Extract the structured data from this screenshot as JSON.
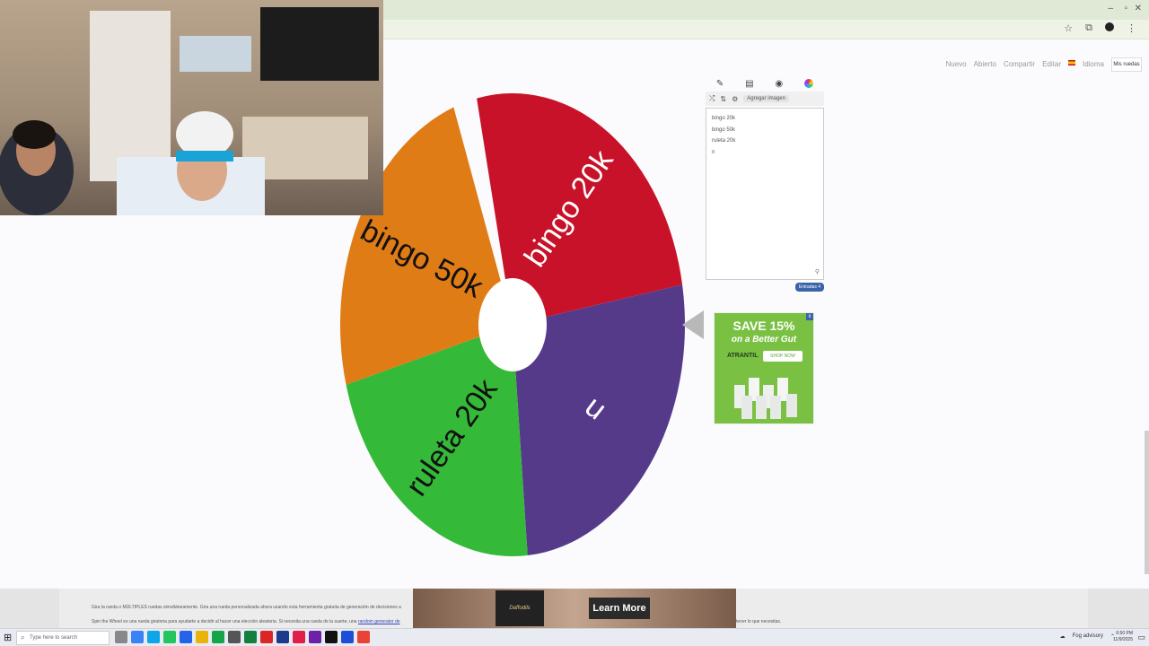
{
  "browser": {
    "window_controls": [
      "–",
      "▫",
      "✕"
    ],
    "toolbar_icons": [
      "☆",
      "⧉",
      "⋮"
    ]
  },
  "nav": {
    "items": [
      "Nuevo",
      "Abierto",
      "Compartir",
      "Editar",
      "",
      "Idioma",
      "Mis ruedas"
    ]
  },
  "wheel": {
    "entries": [
      "bingo 20k",
      "bingo 50k",
      "ruleta 20k",
      "n"
    ],
    "colors": [
      "#c81229",
      "#e07c16",
      "#35b938",
      "#563a8a"
    ]
  },
  "editor": {
    "tools": [
      "pencil-icon",
      "clipboard-icon",
      "eye-icon",
      "palette-icon"
    ],
    "actions": [
      "⤮",
      "⇅",
      "⚙"
    ],
    "add_image": "Agregar imagen",
    "lines": [
      "bingo 20k",
      "bingo 50k",
      "ruleta 20k",
      "n"
    ],
    "count_badge": "Entradas 4"
  },
  "ad": {
    "headline": "SAVE 15%",
    "subline": "on a Better Gut",
    "brand": "ATRANTIL",
    "button": "SHOP NOW",
    "close": "x"
  },
  "footer": {
    "line1": "Gira la rueda o MÚLTIPLES ruedas simultáneamente. Gira una rueda personalizada ahora usando esta herramienta gratuita de generación de decisiones a",
    "line2": "Spin the Wheel es una rueda giratoria para ayudarte a decidir al hacer una elección aleatoria. Si necesita una rueda de la suerte, una",
    "line2_link": "random generator de",
    "line2_end": "tener lo que necesitas.",
    "banner_logo": "Daffodils",
    "learn_more": "Learn More"
  },
  "taskbar": {
    "search_placeholder": "Type here to search",
    "weather": "Fog advisory",
    "time": "6:50 PM",
    "date": "11/9/2025"
  }
}
